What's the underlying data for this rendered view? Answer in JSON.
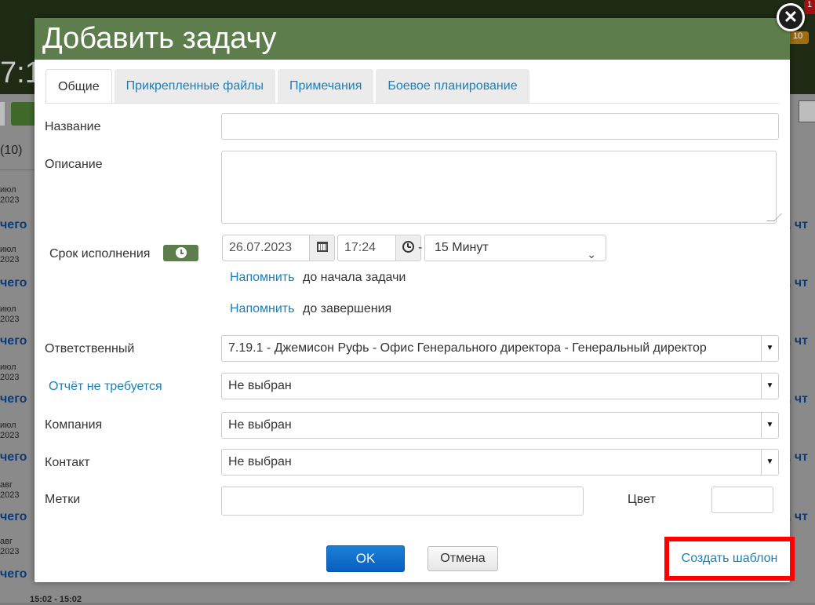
{
  "background": {
    "clock": "7:1",
    "count": "(10)",
    "badge": "1",
    "badge2": "10",
    "rows": [
      {
        "date": "июл\n2023",
        "link": "чего"
      },
      {
        "date": "июл\n2023",
        "link": "чего"
      },
      {
        "date": "июл\n2023",
        "link": "чего"
      },
      {
        "date": "июл\n2023",
        "link": "чего"
      },
      {
        "date": "июл\n2023",
        "link": "чего"
      },
      {
        "date": "авг\n2023",
        "link": "чего"
      },
      {
        "date": "авг\n2023",
        "link": "чего"
      }
    ],
    "right_link": ", чт",
    "footer_time": "15:02 - 15:02"
  },
  "dialog": {
    "title": "Добавить задачу",
    "close_glyph": "✕",
    "tabs": [
      {
        "label": "Общие",
        "active": true
      },
      {
        "label": "Прикрепленные файлы",
        "active": false
      },
      {
        "label": "Примечания",
        "active": false
      },
      {
        "label": "Боевое планирование",
        "active": false
      }
    ],
    "fields": {
      "name": {
        "label": "Название",
        "value": ""
      },
      "description": {
        "label": "Описание",
        "value": ""
      },
      "deadline": {
        "label": "Срок исполнения",
        "date": "26.07.2023",
        "time": "17:24",
        "separator": "-",
        "duration": "15 Минут"
      },
      "reminders": [
        {
          "link": "Напомнить",
          "text": "до начала задачи"
        },
        {
          "link": "Напомнить",
          "text": "до завершения"
        }
      ],
      "responsible": {
        "label": "Ответственный",
        "value": "7.19.1 - Джемисон Руфь - Офис Генерального директора - Генеральный директор"
      },
      "report": {
        "label": "Отчёт не требуется",
        "value": "Не выбран"
      },
      "company": {
        "label": "Компания",
        "value": "Не выбран"
      },
      "contact": {
        "label": "Контакт",
        "value": "Не выбран"
      },
      "tags": {
        "label": "Метки",
        "value": ""
      },
      "color": {
        "label": "Цвет",
        "value": ""
      }
    },
    "buttons": {
      "ok": "OK",
      "cancel": "Отмена",
      "template": "Создать шаблон"
    }
  },
  "colors": {
    "header": "#5d7d4d",
    "link": "#1a7fb8",
    "primary": "#0a5ec0",
    "highlight": "#ff0000"
  }
}
